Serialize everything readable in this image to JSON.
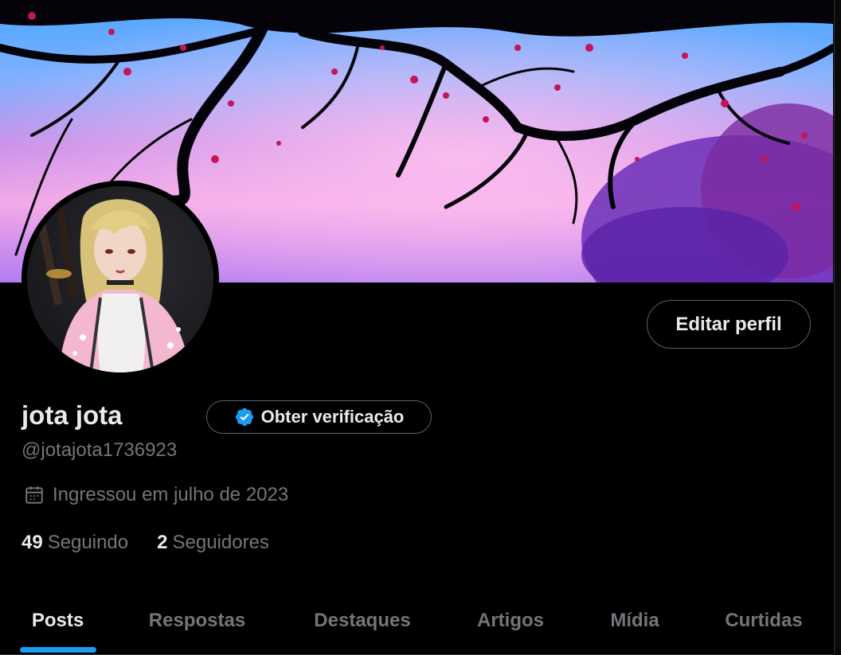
{
  "profile": {
    "display_name": "jota jota",
    "handle": "@jotajota1736923",
    "joined": "Ingressou em julho de 2023",
    "following_count": "49",
    "following_label": "Seguindo",
    "followers_count": "2",
    "followers_label": "Seguidores"
  },
  "buttons": {
    "edit_profile": "Editar perfil",
    "get_verified": "Obter verificação"
  },
  "tabs": [
    {
      "label": "Posts",
      "active": true
    },
    {
      "label": "Respostas",
      "active": false
    },
    {
      "label": "Destaques",
      "active": false
    },
    {
      "label": "Artigos",
      "active": false
    },
    {
      "label": "Mídia",
      "active": false
    },
    {
      "label": "Curtidas",
      "active": false
    }
  ],
  "icons": {
    "verified": "verified-badge-icon",
    "calendar": "calendar-icon"
  },
  "colors": {
    "background": "#000000",
    "text_primary": "#e7e9ea",
    "text_secondary": "#71767b",
    "border": "#536471",
    "accent": "#1d9bf0"
  }
}
